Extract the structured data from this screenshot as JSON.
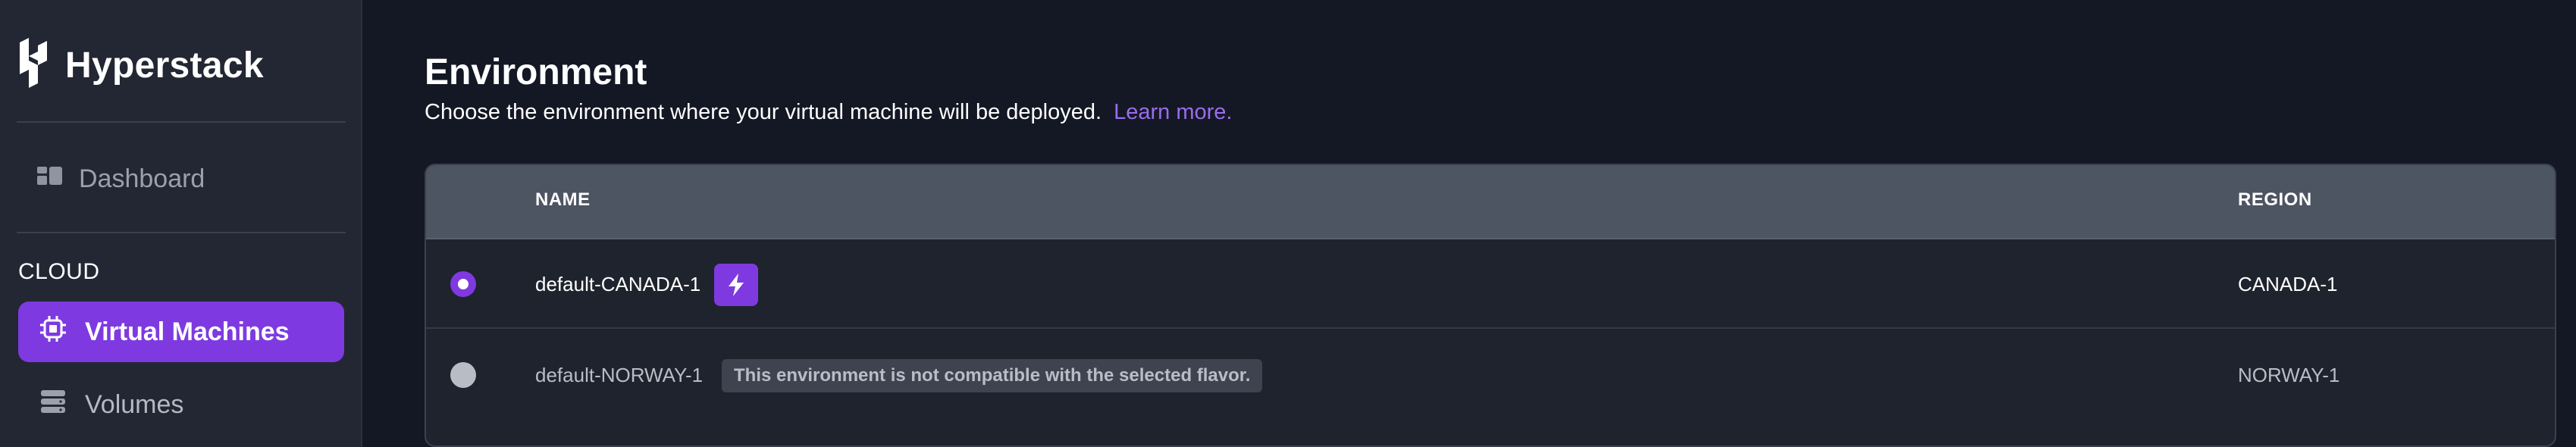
{
  "app": {
    "name": "Hyperstack"
  },
  "sidebar": {
    "dashboard_label": "Dashboard",
    "section_label": "CLOUD",
    "items": [
      {
        "label": "Virtual Machines",
        "active": true,
        "icon": "cpu-chip-icon"
      },
      {
        "label": "Volumes",
        "active": false,
        "icon": "storage-icon"
      }
    ]
  },
  "main": {
    "title": "Environment",
    "subtitle": "Choose the environment where your virtual machine will be deployed.",
    "learn_more": "Learn more."
  },
  "table": {
    "columns": {
      "name": "NAME",
      "region": "REGION"
    },
    "rows": [
      {
        "name": "default-CANADA-1",
        "region": "CANADA-1",
        "selected": true,
        "badge_icon": "lightning-bolt-icon"
      },
      {
        "name": "default-NORWAY-1",
        "region": "NORWAY-1",
        "selected": false,
        "disabled": true,
        "note": "This environment is not compatible with the selected flavor."
      }
    ]
  },
  "colors": {
    "accent": "#7e3ae0",
    "link": "#9a6cf0",
    "sidebar_bg": "#222733",
    "main_bg": "#141824"
  }
}
